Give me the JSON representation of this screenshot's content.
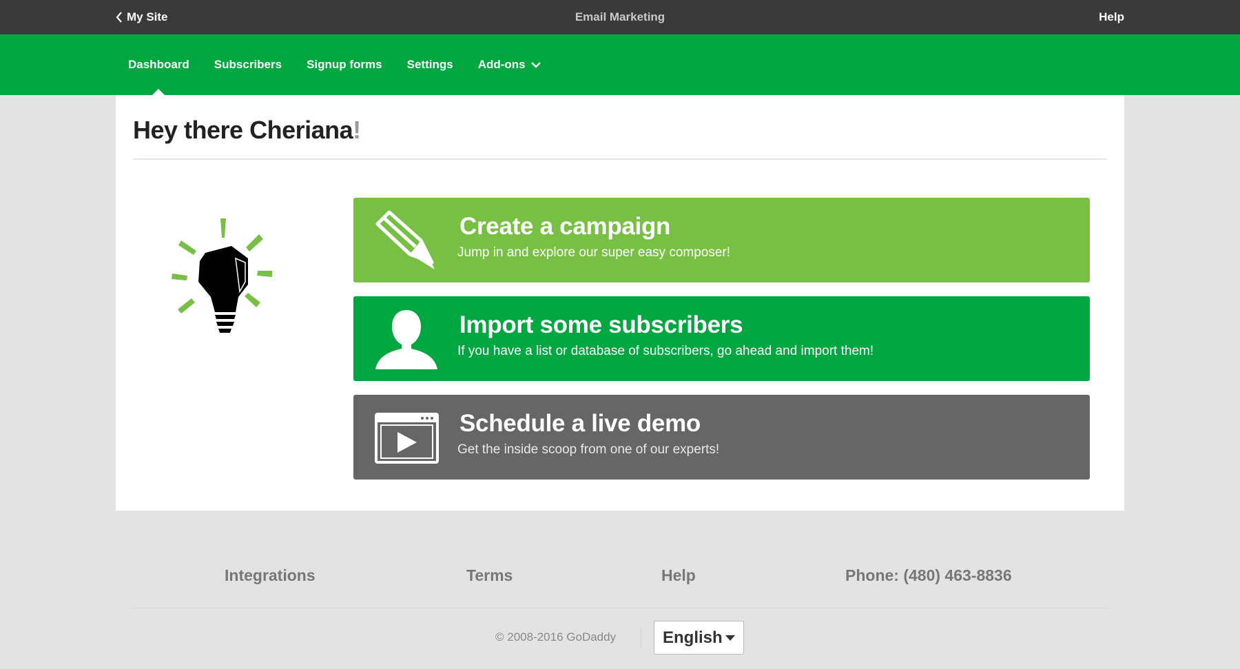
{
  "topbar": {
    "back_label": "My Site",
    "title": "Email Marketing",
    "help_label": "Help"
  },
  "nav": {
    "items": [
      {
        "label": "Dashboard",
        "active": true
      },
      {
        "label": "Subscribers"
      },
      {
        "label": "Signup forms"
      },
      {
        "label": "Settings"
      },
      {
        "label": "Add-ons",
        "has_dropdown": true
      }
    ]
  },
  "main": {
    "greeting": "Hey there Cheriana",
    "greeting_punct": "!",
    "bulb_icon": "lightbulb-icon",
    "actions": [
      {
        "title": "Create a campaign",
        "subtitle": "Jump in and explore our super easy composer!",
        "icon": "pencil-icon",
        "color": "#78c044"
      },
      {
        "title": "Import some subscribers",
        "subtitle": "If you have a list or database of subscribers, go ahead and import them!",
        "icon": "person-icon",
        "color": "#00a63f"
      },
      {
        "title": "Schedule a live demo",
        "subtitle": "Get the inside scoop from one of our experts!",
        "icon": "video-player-icon",
        "color": "#666666"
      }
    ]
  },
  "footer": {
    "links": [
      "Integrations",
      "Terms",
      "Help",
      "Phone: (480) 463-8836"
    ],
    "copyright": "© 2008-2016 GoDaddy",
    "language": "English"
  },
  "colors": {
    "topbar": "#3a3a3a",
    "nav_green": "#00a63f",
    "light_green": "#78c044",
    "gray": "#666666",
    "background": "#e3e3e3"
  }
}
